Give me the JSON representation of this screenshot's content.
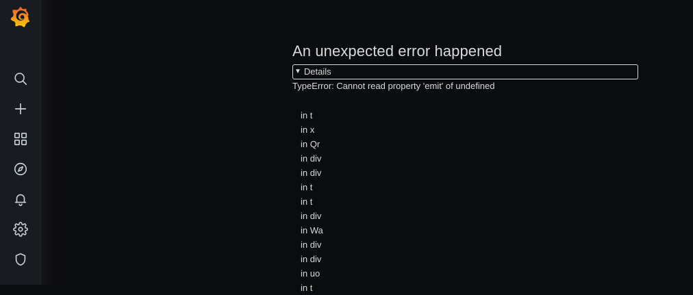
{
  "sidebar": {
    "logo": "grafana-logo",
    "items": [
      {
        "name": "search",
        "icon": "search-icon"
      },
      {
        "name": "create",
        "icon": "plus-icon"
      },
      {
        "name": "dashboards",
        "icon": "dashboards-grid-icon"
      },
      {
        "name": "explore",
        "icon": "compass-icon"
      },
      {
        "name": "alerting",
        "icon": "bell-icon"
      },
      {
        "name": "configuration",
        "icon": "gear-icon"
      },
      {
        "name": "server-admin",
        "icon": "shield-icon"
      }
    ]
  },
  "error": {
    "title": "An unexpected error happened",
    "details_label": "Details",
    "details_toggle": "▼",
    "message": "TypeError: Cannot read property 'emit' of undefined",
    "stack": [
      "in t",
      "in x",
      "in Qr",
      "in div",
      "in div",
      "in t",
      "in t",
      "in div",
      "in Wa",
      "in div",
      "in div",
      "in uo",
      "in t"
    ]
  },
  "colors": {
    "sidebar_bg": "#181b1f",
    "main_bg": "#0b0c0e",
    "text": "#d8d9da",
    "logo_orange": "#f05a28",
    "logo_yellow": "#fbca0a"
  }
}
